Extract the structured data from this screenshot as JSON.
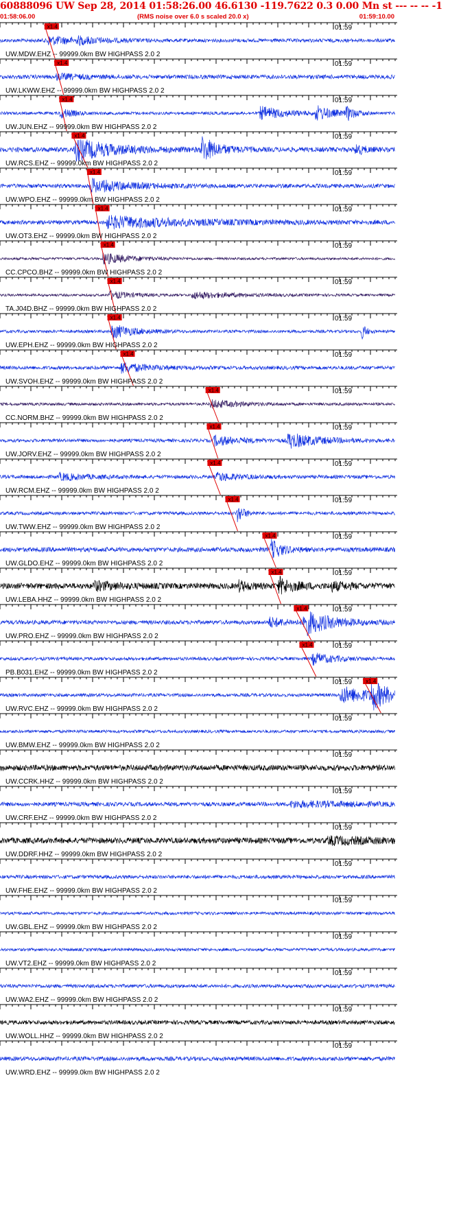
{
  "header": {
    "title": "60888096 UW Sep 28, 2014 01:58:26.00   46.6130 -119.7622  0.3 0.00 Mn st --- -- --  -1",
    "start_time": "01:58:06.00",
    "scaling_note": "(RMS noise over 6.0 s scaled 20.0 x)",
    "end_time": "01:59:10.00"
  },
  "chart_data": {
    "type": "line",
    "title": "60888096 UW Sep 28, 2014 01:58:26.00   46.6130 -119.7622  0.3 0.00 Mn st --- -- --  -1",
    "x_range": [
      "01:58:06.00",
      "01:59:10.00"
    ],
    "x_range_seconds": [
      0,
      64
    ],
    "minute_mark_label": "01:59",
    "minute_mark_seconds": 54,
    "pick_label": "x1.4",
    "legend": "none",
    "grid": false,
    "colors": {
      "title": "#e00000",
      "pick": "#e00000",
      "blue": "#1030e0",
      "purple": "#301860",
      "black": "#000000",
      "axis": "#000000"
    },
    "traces": [
      {
        "label": "UW.MDW.EHZ -- 99999.0km BW  HIGHPASS  2.0  2",
        "color": "blue",
        "noise": 0.22,
        "pick": 7.2,
        "pick_end": 8.9,
        "events": [
          {
            "t": 7.5,
            "dur": 6,
            "amp": 0.5
          },
          {
            "t": 12.5,
            "dur": 4,
            "amp": 0.3
          }
        ]
      },
      {
        "label": "UW.LKWW.EHZ -- 99999.0km BW  HIGHPASS  2.0  2",
        "color": "blue",
        "noise": 0.25,
        "pick": 8.8,
        "pick_end": 10.3,
        "events": [
          {
            "t": 9.0,
            "dur": 5,
            "amp": 0.3
          }
        ]
      },
      {
        "label": "UW.JUN.EHZ -- 99999.0km BW  HIGHPASS  2.0  2",
        "color": "blue",
        "noise": 0.18,
        "pick": 9.6,
        "pick_end": 10.8,
        "events": [
          {
            "t": 9.6,
            "dur": 2.5,
            "amp": 0.6
          },
          {
            "t": 42,
            "dur": 5,
            "amp": 0.8
          },
          {
            "t": 51,
            "dur": 3,
            "amp": 0.9
          },
          {
            "t": 56,
            "dur": 1.5,
            "amp": 0.9
          }
        ]
      },
      {
        "label": "UW.RCS.EHZ -- 99999.0km BW  HIGHPASS  2.0  2",
        "color": "blue",
        "noise": 0.3,
        "pick": 11.6,
        "pick_end": 14.2,
        "events": [
          {
            "t": 12.0,
            "dur": 7,
            "amp": 1.3
          },
          {
            "t": 32.5,
            "dur": 3,
            "amp": 1.6
          },
          {
            "t": 57.5,
            "dur": 1.5,
            "amp": 0.7
          }
        ]
      },
      {
        "label": "UW.WPO.EHZ -- 99999.0km BW  HIGHPASS  2.0  2",
        "color": "blue",
        "noise": 0.25,
        "pick": 14.1,
        "pick_end": 15.1,
        "events": [
          {
            "t": 14.5,
            "dur": 7,
            "amp": 0.8
          }
        ]
      },
      {
        "label": "UW.OT3.EHZ -- 99999.0km BW  HIGHPASS  2.0  2",
        "color": "blue",
        "noise": 0.25,
        "pick": 15.4,
        "pick_end": 16.4,
        "events": [
          {
            "t": 17.0,
            "dur": 16,
            "amp": 0.7
          }
        ]
      },
      {
        "label": "CC.CPCO.BHZ -- 99999.0km BW  HIGHPASS  2.0  2",
        "color": "purple",
        "noise": 0.15,
        "pick": 16.3,
        "pick_end": 17.5,
        "events": [
          {
            "t": 16.5,
            "dur": 5,
            "amp": 0.7
          }
        ]
      },
      {
        "label": "TA.J04D.BHZ -- 99999.0km BW  HIGHPASS  2.0  2",
        "color": "purple",
        "noise": 0.15,
        "pick": 17.4,
        "pick_end": 18.7,
        "events": [
          {
            "t": 17.5,
            "dur": 4,
            "amp": 0.5
          },
          {
            "t": 31,
            "dur": 8,
            "amp": 0.4
          }
        ]
      },
      {
        "label": "UW.EPH.EHZ -- 99999.0km BW  HIGHPASS  2.0  2",
        "color": "blue",
        "noise": 0.18,
        "pick": 17.4,
        "pick_end": 18.8,
        "events": [
          {
            "t": 18.0,
            "dur": 4,
            "amp": 0.9
          },
          {
            "t": 58.5,
            "dur": 0.8,
            "amp": 1.2
          }
        ]
      },
      {
        "label": "UW.SVOH.EHZ -- 99999.0km BW  HIGHPASS  2.0  2",
        "color": "blue",
        "noise": 0.22,
        "pick": 19.5,
        "pick_end": 21.6,
        "events": [
          {
            "t": 19.5,
            "dur": 5,
            "amp": 0.6
          }
        ]
      },
      {
        "label": "CC.NORM.BHZ -- 99999.0km BW  HIGHPASS  2.0  2",
        "color": "purple",
        "noise": 0.17,
        "pick": 33.3,
        "pick_end": 35.4,
        "events": [
          {
            "t": 34.0,
            "dur": 5,
            "amp": 0.5
          }
        ]
      },
      {
        "label": "UW.JORV.EHZ -- 99999.0km BW  HIGHPASS  2.0  2",
        "color": "blue",
        "noise": 0.2,
        "pick": 33.5,
        "pick_end": 35.3,
        "events": [
          {
            "t": 34.5,
            "dur": 5,
            "amp": 0.6
          },
          {
            "t": 46.5,
            "dur": 6,
            "amp": 0.9
          }
        ]
      },
      {
        "label": "UW.RCM.EHZ -- 99999.0km BW  HIGHPASS  2.0  2",
        "color": "blue",
        "noise": 0.22,
        "pick": 33.6,
        "pick_end": 35.7,
        "events": [
          {
            "t": 35.0,
            "dur": 4,
            "amp": 0.5
          },
          {
            "t": 9.5,
            "dur": 5,
            "amp": 0.4
          }
        ]
      },
      {
        "label": "UW.TWW.EHZ -- 99999.0km BW  HIGHPASS  2.0  2",
        "color": "blue",
        "noise": 0.2,
        "pick": 36.5,
        "pick_end": 38.5,
        "events": [
          {
            "t": 38.3,
            "dur": 1.2,
            "amp": 1.3
          }
        ]
      },
      {
        "label": "UW.GLDO.EHZ -- 99999.0km BW  HIGHPASS  2.0  2",
        "color": "blue",
        "noise": 0.28,
        "pick": 42.5,
        "pick_end": 44.7,
        "events": [
          {
            "t": 43.8,
            "dur": 2,
            "amp": 1.3
          }
        ]
      },
      {
        "label": "UW.LEBA.HHZ -- 99999.0km BW  HIGHPASS  2.0  2",
        "color": "black",
        "noise": 0.35,
        "pick": 43.5,
        "pick_end": 45.5,
        "events": [
          {
            "t": 15.0,
            "dur": 4,
            "amp": 0.5
          },
          {
            "t": 38.5,
            "dur": 2,
            "amp": 0.6
          },
          {
            "t": 45.0,
            "dur": 3,
            "amp": 1.0
          },
          {
            "t": 53.5,
            "dur": 3,
            "amp": 0.5
          }
        ]
      },
      {
        "label": "UW.PRO.EHZ -- 99999.0km BW  HIGHPASS  2.0  2",
        "color": "blue",
        "noise": 0.25,
        "pick": 47.6,
        "pick_end": 50.4,
        "events": [
          {
            "t": 49.0,
            "dur": 5,
            "amp": 1.6
          },
          {
            "t": 43.5,
            "dur": 3,
            "amp": 0.6
          }
        ]
      },
      {
        "label": "PB.B031.EHZ -- 99999.0km BW  HIGHPASS  2.0  2",
        "color": "blue",
        "noise": 0.2,
        "pick": 48.5,
        "pick_end": 51.2,
        "events": [
          {
            "t": 50.5,
            "dur": 4,
            "amp": 0.7
          }
        ]
      },
      {
        "label": "UW.RVC.EHZ -- 99999.0km BW  HIGHPASS  2.0  2",
        "color": "blue",
        "noise": 0.2,
        "pick": 58.8,
        "pick_end": 61.7,
        "events": [
          {
            "t": 55.0,
            "dur": 8,
            "amp": 1.0
          },
          {
            "t": 60.0,
            "dur": 3,
            "amp": 1.6
          }
        ]
      },
      {
        "label": "UW.BMW.EHZ -- 99999.0km BW  HIGHPASS  2.0  2",
        "color": "blue",
        "noise": 0.18,
        "events": []
      },
      {
        "label": "UW.CCRK.HHZ -- 99999.0km BW  HIGHPASS  2.0  2",
        "color": "black",
        "noise": 0.35,
        "events": []
      },
      {
        "label": "UW.CRF.EHZ -- 99999.0km BW  HIGHPASS  2.0  2",
        "color": "blue",
        "noise": 0.25,
        "events": [
          {
            "t": 47,
            "dur": 14,
            "amp": 0.3
          }
        ]
      },
      {
        "label": "UW.DDRF.HHZ -- 99999.0km BW  HIGHPASS  2.0  2",
        "color": "black",
        "noise": 0.35,
        "events": [
          {
            "t": 53,
            "dur": 10,
            "amp": 0.35
          }
        ]
      },
      {
        "label": "UW.FHE.EHZ -- 99999.0km BW  HIGHPASS  2.0  2",
        "color": "blue",
        "noise": 0.22,
        "events": []
      },
      {
        "label": "UW.GBL.EHZ -- 99999.0km BW  HIGHPASS  2.0  2",
        "color": "blue",
        "noise": 0.18,
        "events": []
      },
      {
        "label": "UW.VT2.EHZ -- 99999.0km BW  HIGHPASS  2.0  2",
        "color": "blue",
        "noise": 0.18,
        "events": []
      },
      {
        "label": "UW.WA2.EHZ -- 99999.0km BW  HIGHPASS  2.0  2",
        "color": "blue",
        "noise": 0.22,
        "events": []
      },
      {
        "label": "UW.WOLL.HHZ -- 99999.0km BW  HIGHPASS  2.0  2",
        "color": "black",
        "noise": 0.25,
        "events": []
      },
      {
        "label": "UW.WRD.EHZ -- 99999.0km BW  HIGHPASS  2.0  2",
        "color": "blue",
        "noise": 0.25,
        "events": []
      }
    ]
  }
}
